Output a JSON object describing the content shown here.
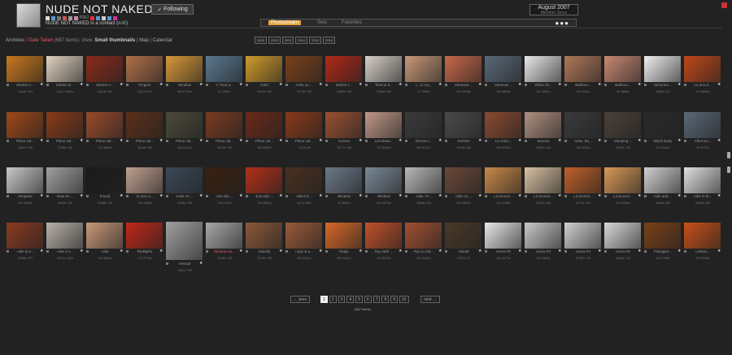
{
  "header": {
    "title": "NUDE NOT NAKED",
    "follow_label": "Following",
    "pro_label": "PRO",
    "contact_text": "NUDE NOT NAKED is a contact",
    "contact_edit": "edit",
    "date": "August 2007",
    "date_sub": "Member Since"
  },
  "nav": {
    "tabs": [
      "Photostream",
      "Sets",
      "Favorites"
    ],
    "more": "●●●"
  },
  "breadcrumb": {
    "archives": "Archives",
    "sep": " / ",
    "date_taken": "Date Taken",
    "count": " (687 items).",
    "view": " View:",
    "small": "Small thumbnails",
    "bar": " | ",
    "map": "Map",
    "calendar": "Calendar"
  },
  "years": [
    "2009",
    "2010",
    "2011",
    "2012",
    "2013",
    "2014"
  ],
  "colors": {
    "accent": "#e8a33d",
    "link_red": "#e56"
  },
  "rows": [
    [
      {
        "label": "Marlen n...",
        "stats": "1544v  31f"
      },
      {
        "label": "Marlen B...",
        "stats": "1441  1080v"
      },
      {
        "label": "Marlen n...",
        "stats": "1615v  30f"
      },
      {
        "label": "Fingers",
        "stats": "18f  2437v"
      },
      {
        "label": "Window",
        "stats": "46f  2716v"
      },
      {
        "label": "V Tired a...",
        "stats": "4f  1061v"
      },
      {
        "label": "Gold",
        "stats": "2553v  29f"
      },
      {
        "label": "Anke on ...",
        "stats": "3778v  72f"
      },
      {
        "label": "Before t...",
        "stats": "2889v  28f"
      },
      {
        "label": "Tired & S...",
        "stats": "2486v  35f"
      },
      {
        "label": "L...in my...",
        "stats": "1f  2965v"
      },
      {
        "label": "Vanessa ...",
        "stats": "24f  2498v"
      },
      {
        "label": "Vanessa ...",
        "stats": "23f  5869v"
      },
      {
        "label": "White sh...",
        "stats": "11f  3591v"
      },
      {
        "label": "Bathroo...",
        "stats": "15f  3411v"
      },
      {
        "label": "Bathroo...",
        "stats": "8f  2868v"
      },
      {
        "label": "Simone's...",
        "stats": "3608v  11f"
      },
      {
        "label": "La dou d...",
        "stats": "47f  3883v"
      }
    ],
    [
      {
        "label": "Place cal...",
        "stats": "2697v  23f"
      },
      {
        "label": "Place cal...",
        "stats": "2785v  18f"
      },
      {
        "label": "Place cal...",
        "stats": "19f  3664v"
      },
      {
        "label": "Place cal...",
        "stats": "3644v  30f"
      },
      {
        "label": "Place cal...",
        "stats": "26f  4104v"
      },
      {
        "label": "Place cal...",
        "stats": "2833v  19f"
      },
      {
        "label": "Place cal...",
        "stats": "38f  3855v"
      },
      {
        "label": "Place cal...",
        "stats": "2767v  8f"
      },
      {
        "label": "Curves",
        "stats": "4177v  48f"
      },
      {
        "label": "Les Beau...",
        "stats": "17f  3666v"
      },
      {
        "label": "Simone i...",
        "stats": "48f  3271v"
      },
      {
        "label": "Kitchen",
        "stats": "3044v  38f"
      },
      {
        "label": "La colon...",
        "stats": "59f  3782v"
      },
      {
        "label": "Simone",
        "stats": "3560v  42f"
      },
      {
        "label": "Anke, Bo...",
        "stats": "18f  4234v"
      },
      {
        "label": "Sleeping ...",
        "stats": "5352v  33f"
      },
      {
        "label": "Black Body",
        "stats": "22f  3142v"
      },
      {
        "label": "Afternoo...",
        "stats": "9f  2379v"
      }
    ],
    [
      {
        "label": "Vergiane",
        "stats": "62f  4255v"
      },
      {
        "label": "Slow on ...",
        "stats": "5469v  33f"
      },
      {
        "label": "Foxed",
        "stats": "3388v  19f"
      },
      {
        "label": "In love a...",
        "stats": "24f  4285v"
      },
      {
        "label": "Anke on ...",
        "stats": "4285v  38f"
      },
      {
        "label": "Just slip ...",
        "stats": "13f  4148v"
      },
      {
        "label": "Just slip i...",
        "stats": "13f  4654v"
      },
      {
        "label": "Adie's lc...",
        "stats": "42f  3738v"
      },
      {
        "label": "Window",
        "stats": "9f  3890v"
      },
      {
        "label": "Window",
        "stats": "61f  4079v"
      },
      {
        "label": "Adie, Fr...",
        "stats": "3696v  32f"
      },
      {
        "label": "Adie on ...",
        "stats": "19f  2605v"
      },
      {
        "label": "La bronze...",
        "stats": "21f  4238v"
      },
      {
        "label": "La bronze...",
        "stats": "5128v  38f"
      },
      {
        "label": "La bronze...",
        "stats": "3273v  41f"
      },
      {
        "label": "La bronze...",
        "stats": "41f  5456v"
      },
      {
        "label": "Adie and ...",
        "stats": "4466v  58f"
      },
      {
        "label": "Adie in th...",
        "stats": "6680v  58f"
      }
    ],
    [
      {
        "label": "Adie & a...",
        "stats": "4288v  47f"
      },
      {
        "label": "Adie in t...",
        "stats": "6621v  162f"
      },
      {
        "label": "Adie",
        "stats": "13f  4623v"
      },
      {
        "label": "Redlights",
        "stats": "17f  3728v"
      },
      {
        "label": "Vertical",
        "stats": "4611v  79f"
      },
      {
        "label": "Window au...",
        "stats": "4235v  12f"
      },
      {
        "label": "Suicide",
        "stats": "3729v  19f"
      },
      {
        "label": "Legs & a...",
        "stats": "29f  4419v"
      },
      {
        "label": "Reign",
        "stats": "49f  4662v"
      },
      {
        "label": "Ryu with ...",
        "stats": "21f  6043v"
      },
      {
        "label": "Ryu in red...",
        "stats": "20f  4941v"
      },
      {
        "label": "Xanda",
        "stats": "4237v  7f"
      },
      {
        "label": "enora #5",
        "stats": "14f  4472v"
      },
      {
        "label": "enora #3",
        "stats": "23f  4464v"
      },
      {
        "label": "enora #4",
        "stats": "4780v  23f"
      },
      {
        "label": "enora #2",
        "stats": "4443v  12f"
      },
      {
        "label": "Foleygen...",
        "stats": "18f  3799v"
      },
      {
        "label": "Unless...",
        "stats": "19f  5436v"
      }
    ]
  ],
  "pagination": {
    "prev": "← prev",
    "pages": [
      "1",
      "2",
      "3",
      "4",
      "5",
      "6",
      "7",
      "8",
      "9",
      "10"
    ],
    "next": "next →",
    "total": "(687 items)"
  }
}
